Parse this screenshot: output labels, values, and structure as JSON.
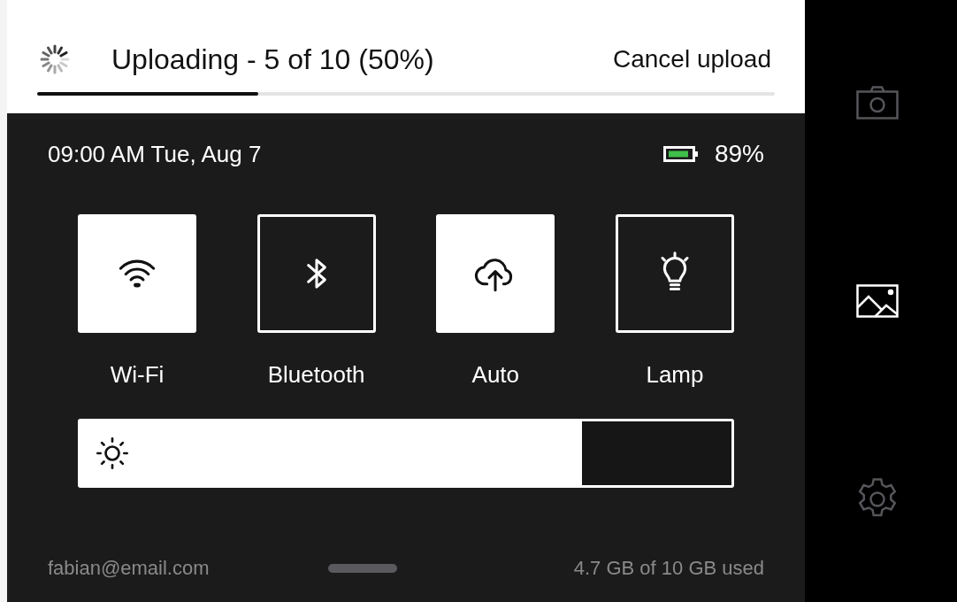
{
  "upload": {
    "label": "Uploading - 5 of 10 (50%)",
    "cancel": "Cancel upload",
    "level": 0.3
  },
  "status": {
    "time": "09:00 AM Tue, Aug 7",
    "battery": "89%"
  },
  "toggles": [
    {
      "kind": "wifi",
      "label": "Wi-Fi",
      "on": true
    },
    {
      "kind": "bluetooth",
      "label": "Bluetooth",
      "on": false
    },
    {
      "kind": "cloud",
      "label": "Auto",
      "on": true
    },
    {
      "kind": "lamp",
      "label": "Lamp",
      "on": false
    }
  ],
  "brightness": {
    "level": 0.77
  },
  "footer": {
    "email": "fabian@email.com",
    "storage": "4.7 GB of 10 GB used"
  },
  "sidebar": {
    "items": [
      {
        "kind": "camera",
        "selected": false
      },
      {
        "kind": "image",
        "selected": true
      },
      {
        "kind": "settings",
        "selected": false
      }
    ]
  }
}
